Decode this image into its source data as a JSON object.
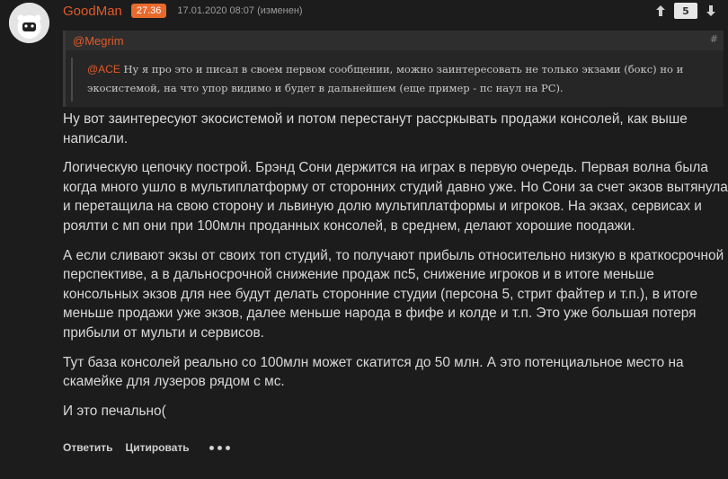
{
  "post": {
    "username": "GoodMan",
    "reputation": "27.36",
    "date": "17.01.2020 08:07 (изменен)",
    "vote_count": "5"
  },
  "quote": {
    "author": "@Megrim",
    "hash": "#",
    "inner_author": "@ACE",
    "inner_text": " Ну я про это и писал в своем первом сообщении, можно заинтересовать не только экзами (бокс) но и экосистемой, на что упор видимо и будет в дальнейшем (еще пример - пс наул на PC)."
  },
  "body": {
    "paragraphs": [
      "Ну вот заинтересуют экосистемой и потом перестанут рассркывать продажи консолей, как выше написали.",
      "Логическую цепочку построй. Брэнд Сони держится на играх в первую очередь. Первая волна была когда много ушло в мультиплатформу от сторонних студий давно уже. Но Сони за счет экзов вытянула и перетащила на свою сторону и львиную долю мультиплатформы и игроков. На экзах, сервисах и роялти с мп они при 100млн проданных консолей, в среднем, делают хорошие поодажи.",
      "А если сливают экзы от своих топ студий, то получают прибыль относительно низкую в краткосрочной перспективе, а в дальносрочной снижение продаж пс5, снижение игроков и в итоге меньше консольных экзов для нее будут делать сторонние студии (персона 5, стрит файтер и т.п.), в итоге меньше продажи уже экзов, далее меньше народа в фифе и колде и т.п. Это уже большая потеря прибыли от мульти и сервисов.",
      "Тут база консолей реально со 100млн может скатится до 50 млн. А это потенциальное место на скамейке для лузеров рядом с мс.",
      "И это печально("
    ]
  },
  "actions": {
    "reply": "Ответить",
    "quote": "Цитировать"
  },
  "icons": {
    "upvote": "arrow-up-icon",
    "downvote": "arrow-down-icon",
    "more": "more-dots-icon"
  },
  "colors": {
    "background": "#1c1c1c",
    "accent": "#e0592a",
    "badge": "#e86a2d",
    "text": "#d8d8d8"
  }
}
